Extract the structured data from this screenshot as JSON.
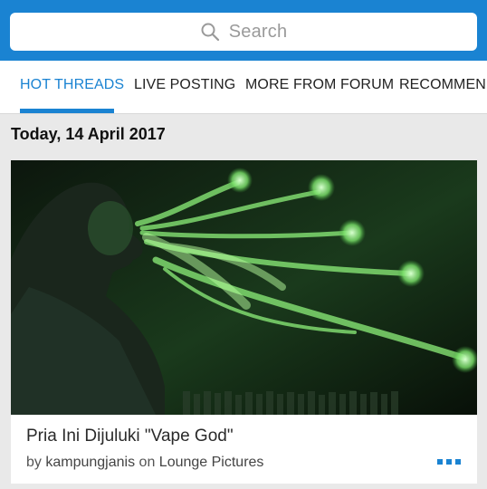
{
  "search": {
    "placeholder": "Search",
    "icon": "search-icon"
  },
  "tabs": [
    {
      "label": "HOT THREADS",
      "active": true
    },
    {
      "label": "LIVE POSTING",
      "active": false
    },
    {
      "label": "MORE FROM FORUM",
      "active": false
    },
    {
      "label": "RECOMMEND",
      "active": false
    }
  ],
  "feed": {
    "date_header": "Today, 14 April 2017",
    "cards": [
      {
        "title": "Pria Ini Dijuluki \"Vape God\"",
        "by_prefix": "by",
        "author": "kampungjanis",
        "on_word": "on",
        "forum": "Lounge Pictures",
        "more_icon": "more-dots-icon"
      }
    ]
  },
  "colors": {
    "brand_blue": "#1a83d2",
    "tab_text": "#222222",
    "background": "#e9e9e9"
  }
}
